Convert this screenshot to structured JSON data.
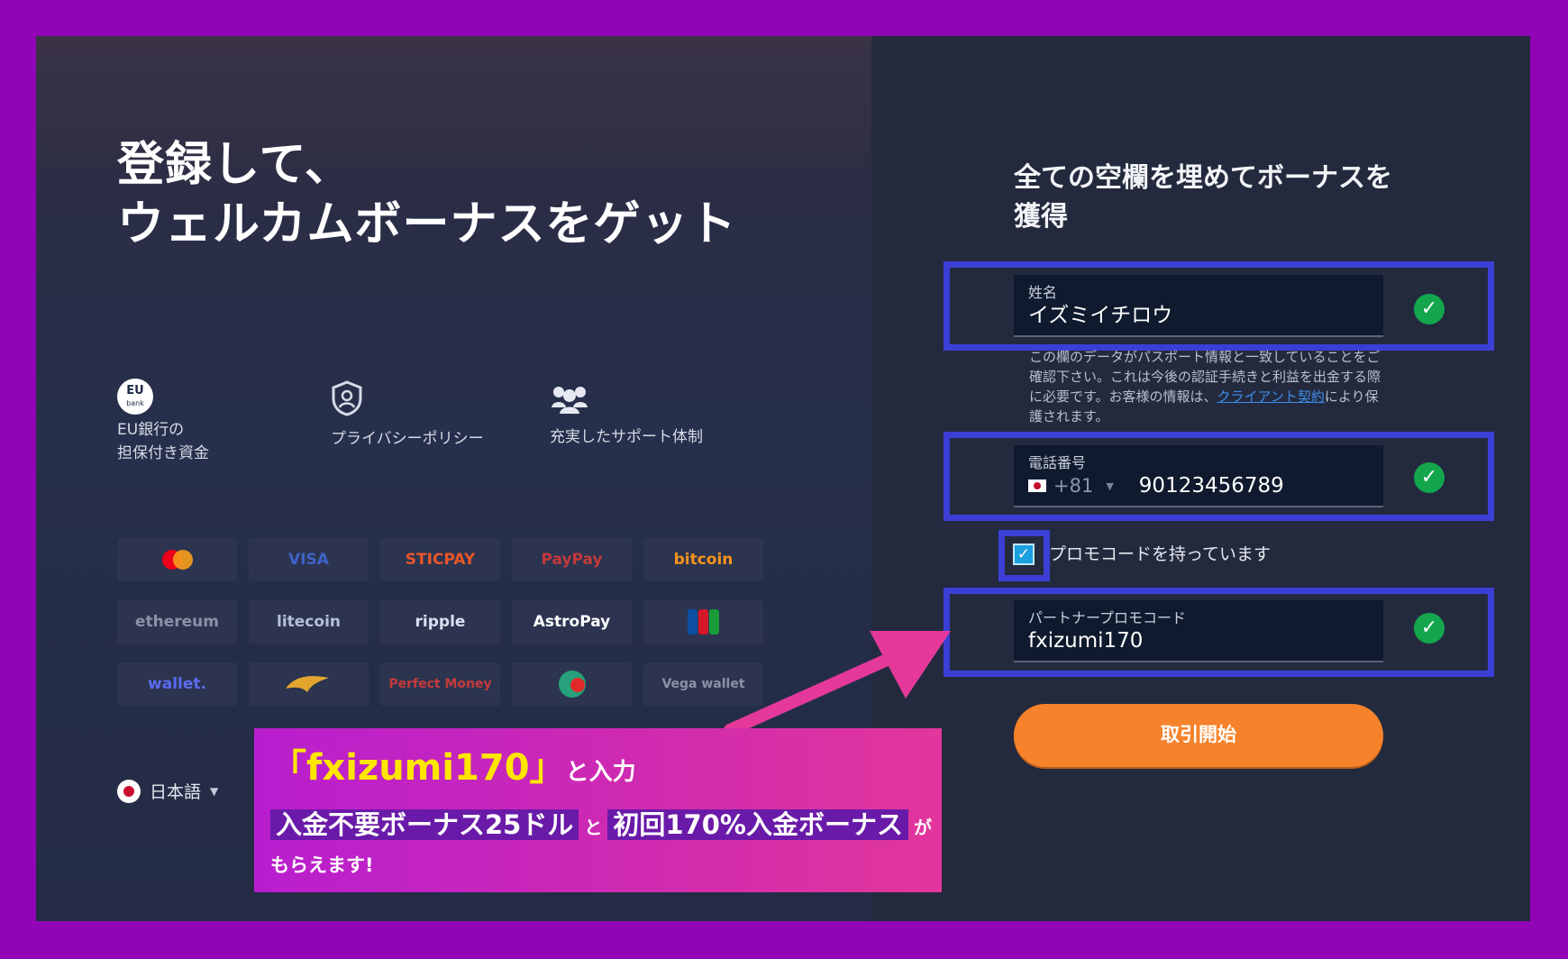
{
  "headline": {
    "line1": "登録して、",
    "line2": "ウェルカムボーナスをゲット"
  },
  "features": [
    {
      "icon": "eu-bank-icon",
      "badge": "EU",
      "badge_sub": "bank",
      "line1": "EU銀行の",
      "line2": "担保付き資金"
    },
    {
      "icon": "shield-user-icon",
      "line1": "プライバシーポリシー"
    },
    {
      "icon": "support-people-icon",
      "line1": "充実したサポート体制"
    }
  ],
  "payments": [
    {
      "label": "",
      "icon": "mastercard-icon"
    },
    {
      "label": "VISA",
      "color": "#3f63c8"
    },
    {
      "label": "STICPAY",
      "color": "#e8562a"
    },
    {
      "label": "PayPay",
      "color": "#c23a3a"
    },
    {
      "label": "bitcoin",
      "color": "#f7931a"
    },
    {
      "label": "ethereum",
      "color": "#8a92a6"
    },
    {
      "label": "litecoin",
      "color": "#b5bfd6"
    },
    {
      "label": "ripple",
      "color": "#d9dff0"
    },
    {
      "label": "AstroPay",
      "color": "#ffffff"
    },
    {
      "label": "",
      "icon": "jcb-icon"
    },
    {
      "label": "wallet.",
      "color": "#5b6cf0"
    },
    {
      "label": "",
      "icon": "bird-logo-icon"
    },
    {
      "label": "Perfect Money",
      "color": "#c63a3a"
    },
    {
      "label": "",
      "icon": "tether-icon"
    },
    {
      "label": "Vega wallet",
      "color": "#8a92a6"
    }
  ],
  "language": {
    "label": "日本語"
  },
  "form": {
    "title": "全ての空欄を埋めてボーナスを獲得",
    "name": {
      "label": "姓名",
      "value": "イズミイチロウ"
    },
    "helper_text": "この欄のデータがパスポート情報と一致していることをご確認下さい。これは今後の認証手続きと利益を出金する際に必要です。お客様の情報は、",
    "helper_link": "クライアント契約",
    "helper_tail": "により保護されます。",
    "phone": {
      "label": "電話番号",
      "dial_code": "+81",
      "value": "90123456789"
    },
    "promo_toggle_label": "プロモコードを持っています",
    "promo": {
      "label": "パートナープロモコード",
      "value": "fxizumi170"
    },
    "submit_label": "取引開始"
  },
  "callout": {
    "title": "「fxizumi170」",
    "title_suffix": "と入力",
    "bonus1": "入金不要ボーナス25ドル",
    "and": "と",
    "bonus2": "初回170%入金ボーナス",
    "particle": "が",
    "sub": "もらえます!"
  },
  "colors": {
    "accent": "#f6832c",
    "highlight": "#3b3fd6",
    "success": "#13a64d",
    "callout": "#cf2ab1",
    "background": "#9205b7"
  }
}
